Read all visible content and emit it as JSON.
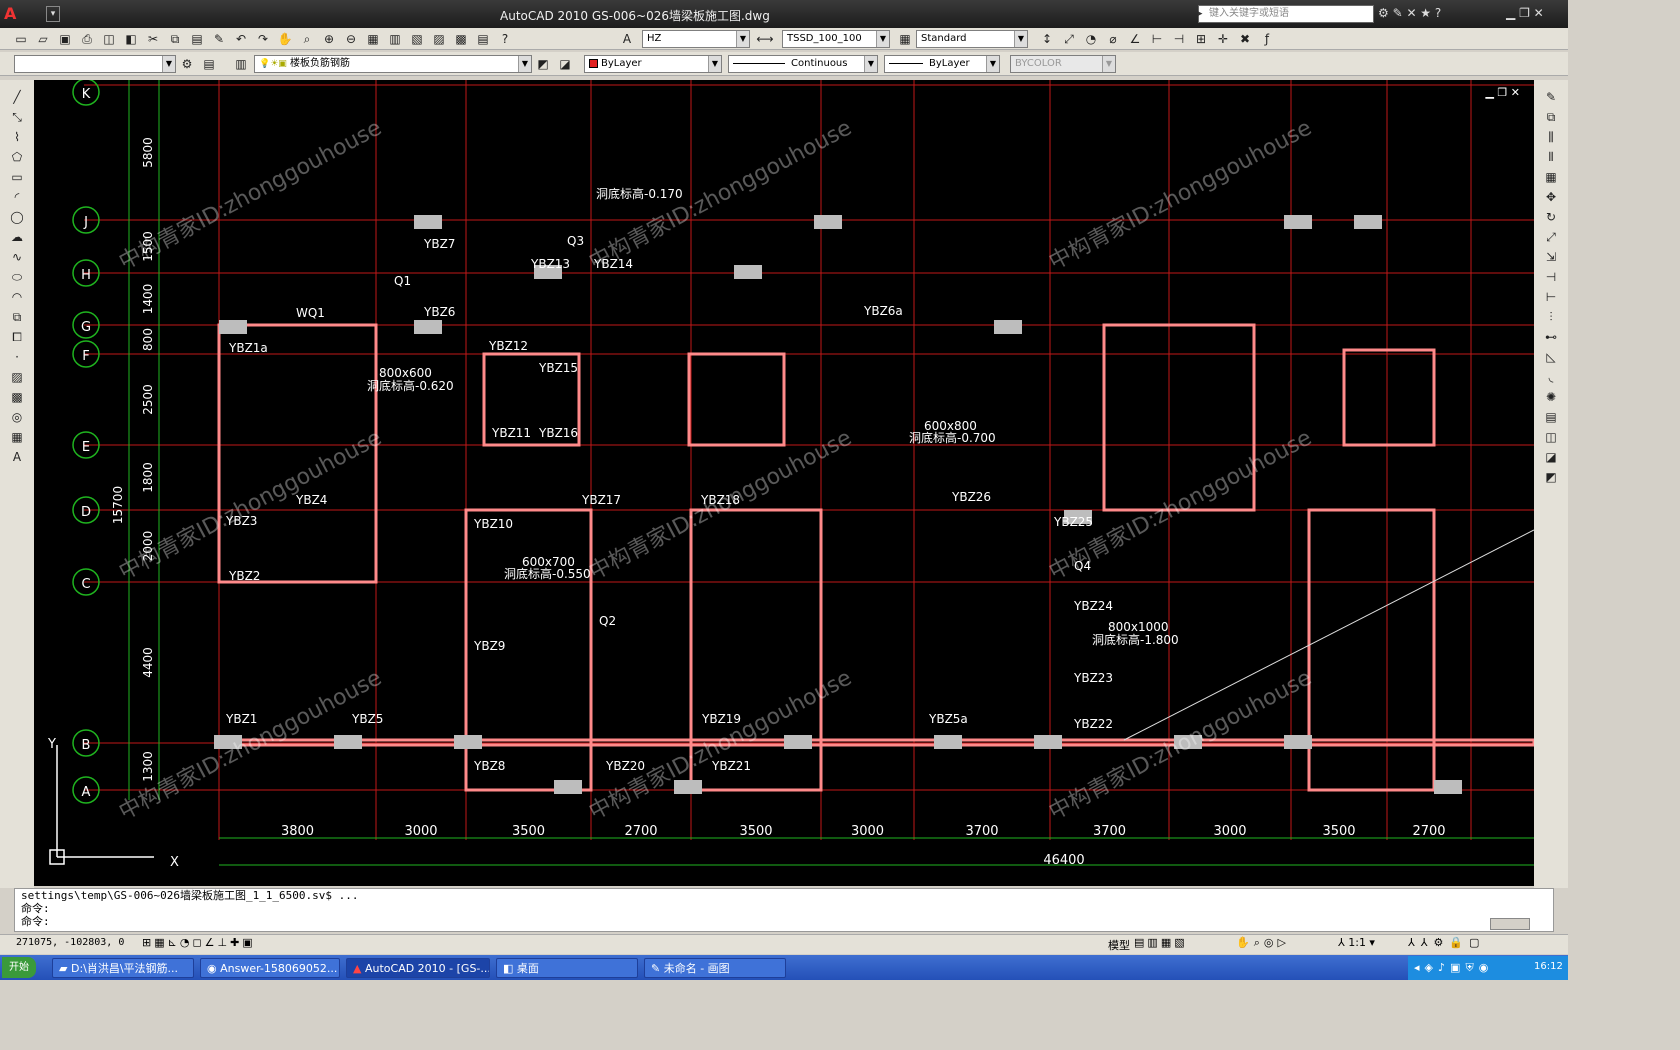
{
  "app": {
    "logo_letter": "A",
    "title": "AutoCAD 2010    GS-006~026墙梁板施工图.dwg",
    "search_placeholder": "键入关键字或短语"
  },
  "toolbar_row1": {
    "text_style": "HZ",
    "dim_style": "TSSD_100_100",
    "table_style": "Standard"
  },
  "toolbar_row2": {
    "layer_state": "",
    "layer_name": "楼板负筋钢筋",
    "color": "ByLayer",
    "color_swatch": "#e02020",
    "linetype": "Continuous",
    "lineweight": "ByLayer",
    "plotstyle": "BYCOLOR"
  },
  "drawing": {
    "grid_labels_y": [
      "K",
      "J",
      "H",
      "G",
      "F",
      "E",
      "D",
      "C",
      "B",
      "A"
    ],
    "row_dims": [
      "5800",
      "1500",
      "1400",
      "800",
      "2500",
      "1800",
      "2000",
      "4400",
      "1300"
    ],
    "total_side_dim": "15700",
    "col_dims": [
      "3800",
      "3000",
      "3500",
      "2700",
      "3500",
      "3000",
      "3700",
      "3700",
      "3000",
      "3500",
      "2700"
    ],
    "total_bottom_dim": "46400",
    "labels": [
      "YBZ1a",
      "YBZ7",
      "YBZ6",
      "YBZ4",
      "YBZ3",
      "YBZ2",
      "YBZ1",
      "YBZ5",
      "YBZ8",
      "YBZ9",
      "YBZ10",
      "YBZ11",
      "YBZ12",
      "YBZ13",
      "YBZ14",
      "YBZ15",
      "YBZ16",
      "YBZ17",
      "YBZ18",
      "YBZ19",
      "YBZ20",
      "YBZ21",
      "YBZ22",
      "YBZ23",
      "YBZ24",
      "YBZ25",
      "YBZ26",
      "YBZ5a",
      "YBZ6a",
      "WQ1",
      "Q1",
      "Q2",
      "Q3",
      "Q4"
    ],
    "openings": [
      "800x600",
      "600x700",
      "600x800",
      "800x1000"
    ],
    "elevations": [
      "洞底标高-0.620",
      "洞底标高-0.550",
      "洞底标高-0.700",
      "洞底标高-1.800",
      "洞底标高-0.170"
    ],
    "watermark": "中构青家ID:zhonggouhouse",
    "ucs_x": "X",
    "ucs_y": "Y"
  },
  "command": {
    "line1": "settings\\temp\\GS-006~026墙梁板施工图_1_1_6500.sv$ ...",
    "line2": "命令:",
    "line3": "命令:"
  },
  "status": {
    "coords": "271075, -102803, 0",
    "model_label": "模型",
    "scale": "1:1"
  },
  "taskbar": {
    "start": "开始",
    "items": [
      "D:\\肖洪昌\\平法钢筋...",
      "Answer-158069052...",
      "AutoCAD 2010 - [GS-...",
      "桌面",
      "未命名 - 画图"
    ],
    "clock": "16:12"
  }
}
